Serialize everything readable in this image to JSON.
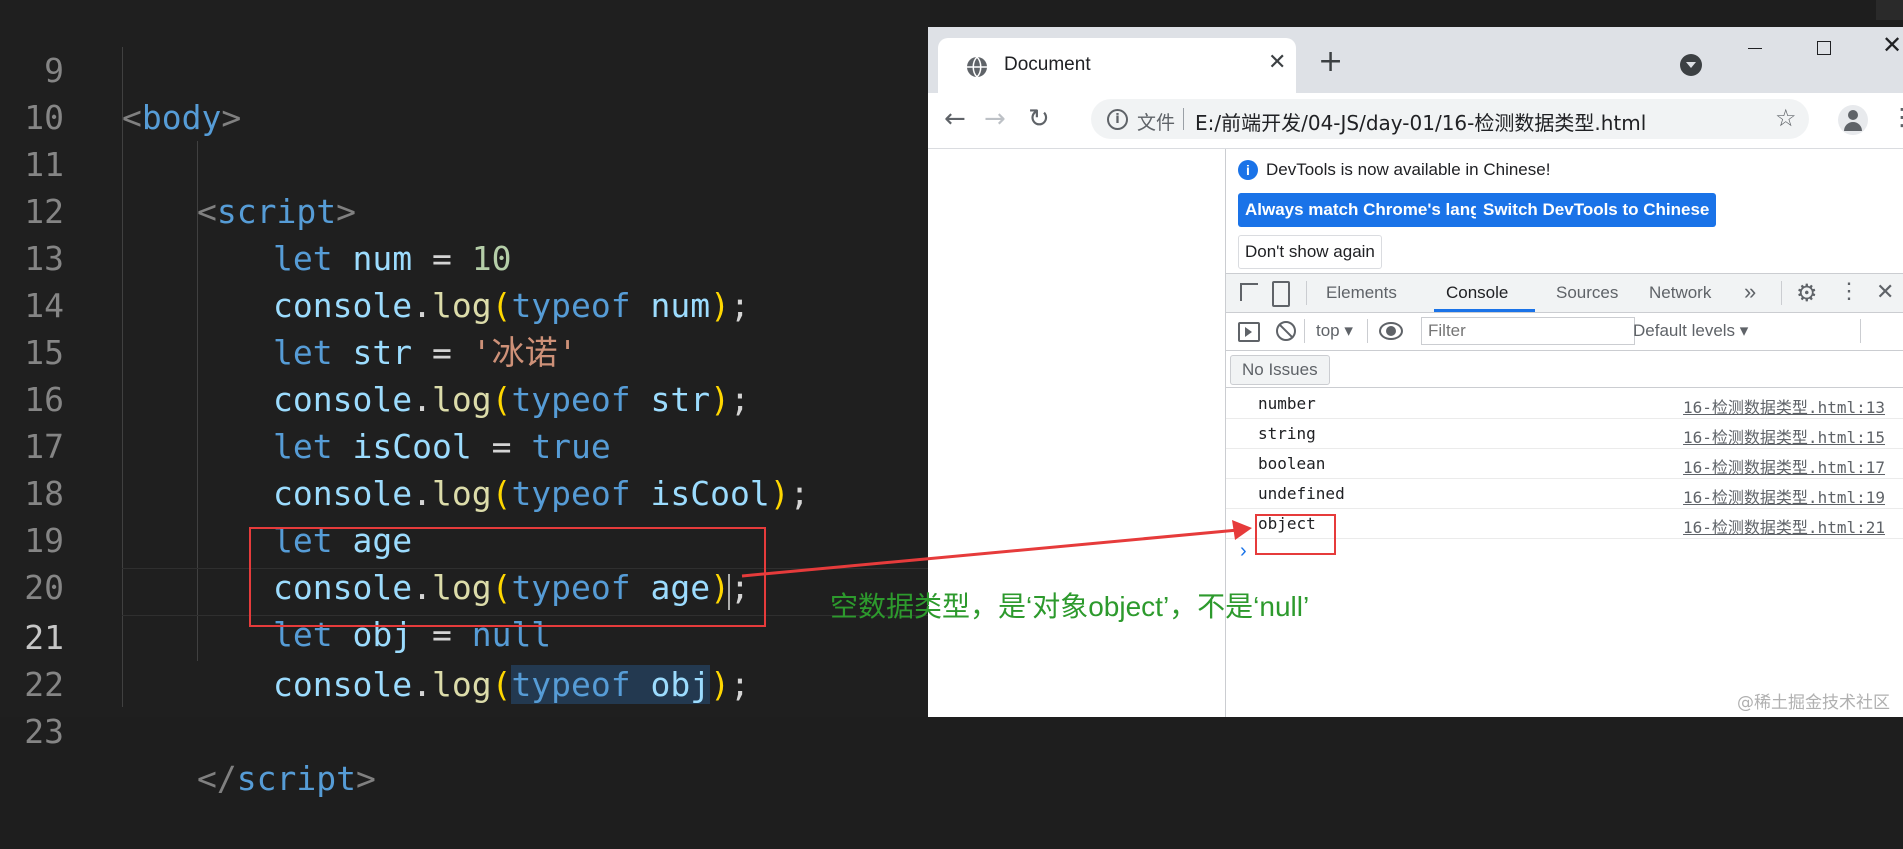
{
  "editor": {
    "lines": [
      {
        "n": "9"
      },
      {
        "n": "10"
      },
      {
        "n": "11"
      },
      {
        "n": "12"
      },
      {
        "n": "13"
      },
      {
        "n": "14"
      },
      {
        "n": "15"
      },
      {
        "n": "16"
      },
      {
        "n": "17"
      },
      {
        "n": "18"
      },
      {
        "n": "19"
      },
      {
        "n": "20"
      },
      {
        "n": "21"
      },
      {
        "n": "22"
      },
      {
        "n": "23"
      }
    ],
    "tokens": {
      "lt": "<",
      "gt": ">",
      "body": "body",
      "script": "script",
      "close_lt": "</",
      "let": "let",
      "num": "num",
      "eq": " = ",
      "ten": "10",
      "console": "console",
      "dot": ".",
      "log": "log",
      "lp": "(",
      "rp": ")",
      "semi": ";",
      "typeof": "typeof",
      "str": "str",
      "bingnuo": "'冰诺'",
      "isCool": "isCool",
      "true": "true",
      "age": "age",
      "obj": "obj",
      "null": "null",
      "sp": " "
    }
  },
  "browser": {
    "tab_title": "Document",
    "close_glyph": "✕",
    "newtab_glyph": "+",
    "omnibox_chip": "文件",
    "url": "E:/前端开发/04-JS/day-01/16-检测数据类型.html",
    "star_glyph": "☆",
    "kebab_glyph": "⋮",
    "back_glyph": "←",
    "forward_glyph": "→",
    "reload_glyph": "↻",
    "info_glyph": "i"
  },
  "devtools": {
    "banner_text": "DevTools is now available in Chinese!",
    "btn_match": "Always match Chrome's language",
    "btn_switch": "Switch DevTools to Chinese",
    "btn_dont_show": "Don't show again",
    "tabs": [
      "Elements",
      "Console",
      "Sources",
      "Network"
    ],
    "more_tabs": "»",
    "gear": "⚙",
    "kebab": "⋮",
    "close": "✕",
    "context": "top ▾",
    "filter_placeholder": "Filter",
    "levels": "Default levels ▾",
    "no_issues": "No Issues",
    "prompt": "›",
    "logs": [
      {
        "msg": "number",
        "src": "16-检测数据类型.html:13"
      },
      {
        "msg": "string",
        "src": "16-检测数据类型.html:15"
      },
      {
        "msg": "boolean",
        "src": "16-检测数据类型.html:17"
      },
      {
        "msg": "undefined",
        "src": "16-检测数据类型.html:19"
      },
      {
        "msg": "object",
        "src": "16-检测数据类型.html:21"
      }
    ]
  },
  "annotation": "空数据类型，是‘对象object’，不是‘null’",
  "watermark": "@稀土掘金技术社区",
  "colors": {
    "highlight": "#e63b3b",
    "annotation": "#2d9a2d",
    "accent": "#1a73e8"
  }
}
